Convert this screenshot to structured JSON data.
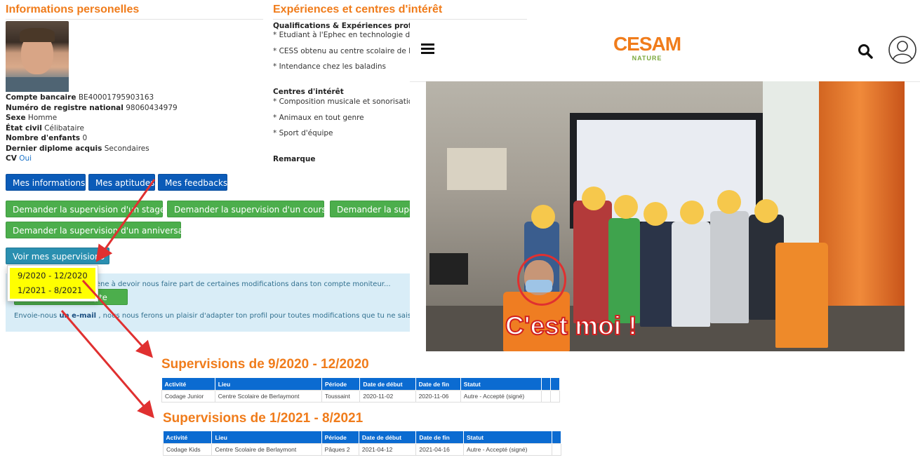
{
  "profile": {
    "section_title": "Informations personelles",
    "fields": [
      {
        "label": "Compte bancaire",
        "value": "BE40001795903163"
      },
      {
        "label": "Numéro de registre national",
        "value": "98060434979"
      },
      {
        "label": "Sexe",
        "value": "Homme"
      },
      {
        "label": "État civil",
        "value": "Célibataire"
      },
      {
        "label": "Nombre d'enfants",
        "value": "0"
      },
      {
        "label": "Dernier diplome acquis",
        "value": "Secondaires"
      },
      {
        "label": "CV",
        "value": "Oui"
      }
    ]
  },
  "nav_buttons": {
    "info": "Mes informations",
    "aptitudes": "Mes aptitudes",
    "feedbacks": "Mes feedbacks"
  },
  "request_buttons": {
    "stage": "Demander la supervision d'un stage",
    "cours": "Demander la supervision d'un cours",
    "truncated": "Demander la super",
    "anniversaire": "Demander la supervision d'un anniversaire"
  },
  "supervisions": {
    "button": "Voir mes supervisions",
    "options": [
      "9/2020 - 12/2020",
      "1/2021 - 8/2021"
    ]
  },
  "notice": {
    "line1": "Si un changement t'amène à devoir nous faire part de certaines modifications dans ton compte moniteur...",
    "button": "Modifier mon compte",
    "line2_before": "Envoie-nous",
    "line2_link": "un e-mail",
    "line2_after": ", nous nous ferons un plaisir d'adapter ton profil pour toutes modifications que tu ne saisis pas toi-même."
  },
  "experience": {
    "section_title": "Expériences et centres d'intérêt",
    "qualifications_title": "Qualifications & Expériences professionnelles",
    "qualifications": [
      "* Etudiant à l'Ephec en technologie de l'informatique",
      "* CESS obtenu au centre scolaire de Berlaymont",
      "* Intendance chez les baladins"
    ],
    "interests_title": "Centres d'intérêt",
    "interests": [
      "* Composition musicale et sonorisation",
      "* Animaux en tout genre",
      "* Sport d'équipe"
    ],
    "remark_title": "Remarque"
  },
  "site": {
    "logo_text": "CESAM",
    "logo_sub": "NATURE",
    "icons": [
      "hamburger-menu-icon",
      "search-icon",
      "user-account-icon"
    ]
  },
  "photo": {
    "caption": "C'est moi !"
  },
  "tables": [
    {
      "title": "Supervisions de 9/2020 - 12/2020",
      "headers": [
        "Activité",
        "Lieu",
        "Période",
        "Date de début",
        "Date de fin",
        "Statut"
      ],
      "rows": [
        [
          "Codage Junior",
          "Centre Scolaire de Berlaymont",
          "Toussaint",
          "2020-11-02",
          "2020-11-06",
          "Autre - Accepté (signé)"
        ]
      ]
    },
    {
      "title": "Supervisions de 1/2021 - 8/2021",
      "headers": [
        "Activité",
        "Lieu",
        "Période",
        "Date de début",
        "Date de fin",
        "Statut"
      ],
      "rows": [
        [
          "Codage Kids",
          "Centre Scolaire de Berlaymont",
          "Pâques 2",
          "2021-04-12",
          "2021-04-16",
          "Autre - Accepté (signé)"
        ]
      ]
    }
  ],
  "colors": {
    "orange": "#f07c1b",
    "blue_button": "#0b5bb8",
    "green_button": "#4cae4c",
    "table_header": "#0b6bd1",
    "highlight": "#ffff00",
    "annotation_red": "#e03030"
  }
}
